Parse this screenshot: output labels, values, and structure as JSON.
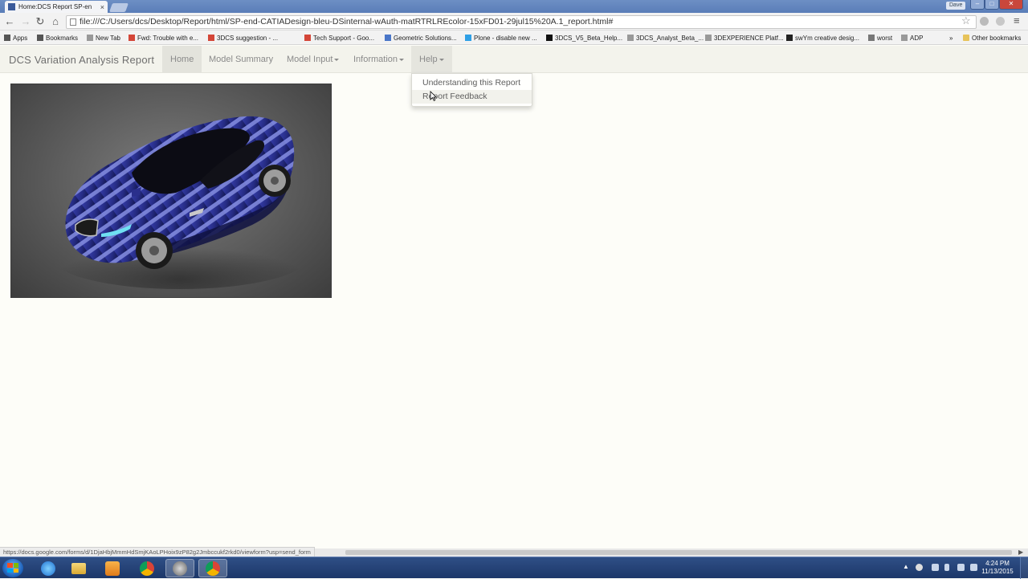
{
  "browser": {
    "tab_title": "Home:DCS Report SP-en",
    "tab_close": "×",
    "user_badge": "Dave",
    "window_buttons": {
      "minimize": "–",
      "maximize": "□",
      "close": "✕"
    },
    "nav": {
      "back": "←",
      "forward": "→",
      "reload": "↻",
      "home": "⌂"
    },
    "url": "file:///C:/Users/dcs/Desktop/Report/html/SP-end-CATIADesign-bleu-DSinternal-wAuth-matRTRLREcolor-15xFD01-29jul15%20A.1_report.html#",
    "star": "☆",
    "menu": "≡"
  },
  "bookmarks": [
    {
      "label": "Apps",
      "icon": "apps-grid-icon",
      "color": "#555555"
    },
    {
      "label": "Bookmarks",
      "icon": "star-icon",
      "color": "#555555"
    },
    {
      "label": "New Tab",
      "icon": "page-icon",
      "color": "#999999"
    },
    {
      "label": "Fwd: Trouble with e...",
      "icon": "gmail-icon",
      "color": "#d44638"
    },
    {
      "label": "3DCS suggestion - ...",
      "icon": "gmail-icon",
      "color": "#d44638"
    },
    {
      "label": "Tech Support - Goo...",
      "icon": "gmail-icon",
      "color": "#d44638"
    },
    {
      "label": "Geometric Solutions...",
      "icon": "google-docs-icon",
      "color": "#4a76c8"
    },
    {
      "label": "Plone - disable new ...",
      "icon": "twitter-icon",
      "color": "#2fa0e6"
    },
    {
      "label": "3DCS_V5_Beta_Help...",
      "icon": "notion-icon",
      "color": "#111111"
    },
    {
      "label": "3DCS_Analyst_Beta_...",
      "icon": "page-icon",
      "color": "#999999"
    },
    {
      "label": "3DEXPERIENCE Platf...",
      "icon": "page-icon",
      "color": "#999999"
    },
    {
      "label": "swYm creative desig...",
      "icon": "3ds-icon",
      "color": "#222222"
    },
    {
      "label": "worst",
      "icon": "link-icon",
      "color": "#777777"
    },
    {
      "label": "ADP",
      "icon": "page-icon",
      "color": "#999999"
    }
  ],
  "bookmarks_more": "»",
  "bookmarks_other": "Other bookmarks",
  "page": {
    "brand": "DCS Variation Analysis Report",
    "nav": {
      "home": "Home",
      "summary": "Model Summary",
      "input": "Model Input",
      "information": "Information",
      "help": "Help"
    },
    "help_menu": {
      "understanding": "Understanding this Report",
      "feedback": "Report Feedback"
    }
  },
  "status_url": "https://docs.google.com/forms/d/1DjaHbjMmmHdSmjKAoLPHoix9zP82g2Jmbccukf2rkd0/viewform?usp=send_form",
  "taskbar": {
    "clock_time": "4:24 PM",
    "clock_date": "11/13/2015",
    "tray_up": "▲"
  },
  "colors": {
    "page_bg": "#fdfdf8",
    "navbar_bg": "#f3f3ec",
    "car_body": "#2a2f8c",
    "taskbar": "#1c3769"
  }
}
